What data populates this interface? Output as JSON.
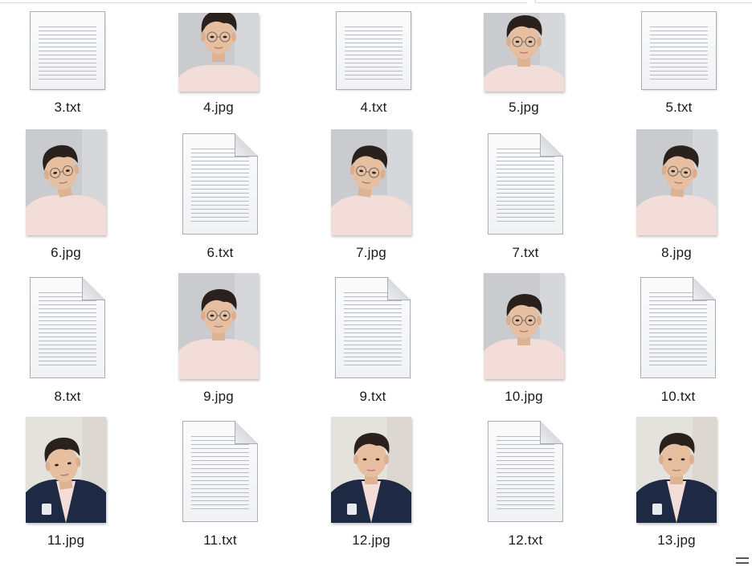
{
  "files": [
    {
      "name": "3.txt",
      "type": "txt"
    },
    {
      "name": "4.jpg",
      "type": "jpg",
      "variant": "wide"
    },
    {
      "name": "4.txt",
      "type": "txt"
    },
    {
      "name": "5.jpg",
      "type": "jpg",
      "variant": "front"
    },
    {
      "name": "5.txt",
      "type": "txt"
    },
    {
      "name": "6.jpg",
      "type": "jpg",
      "variant": "tilt-left"
    },
    {
      "name": "6.txt",
      "type": "txt"
    },
    {
      "name": "7.jpg",
      "type": "jpg",
      "variant": "look-down"
    },
    {
      "name": "7.txt",
      "type": "txt"
    },
    {
      "name": "8.jpg",
      "type": "jpg",
      "variant": "side-right"
    },
    {
      "name": "8.txt",
      "type": "txt"
    },
    {
      "name": "9.jpg",
      "type": "jpg",
      "variant": "front"
    },
    {
      "name": "9.txt",
      "type": "txt"
    },
    {
      "name": "10.jpg",
      "type": "jpg",
      "variant": "front-low"
    },
    {
      "name": "10.txt",
      "type": "txt"
    },
    {
      "name": "11.jpg",
      "type": "jpg",
      "variant": "jacket-tilt"
    },
    {
      "name": "11.txt",
      "type": "txt"
    },
    {
      "name": "12.jpg",
      "type": "jpg",
      "variant": "jacket"
    },
    {
      "name": "12.txt",
      "type": "txt"
    },
    {
      "name": "13.jpg",
      "type": "jpg",
      "variant": "jacket"
    }
  ],
  "colors": {
    "shirt": "#f2ddd8",
    "skin": "#e6bfa1",
    "hair": "#2a211d",
    "jacket": "#1e2a44",
    "wall": "#c9cbcf"
  }
}
